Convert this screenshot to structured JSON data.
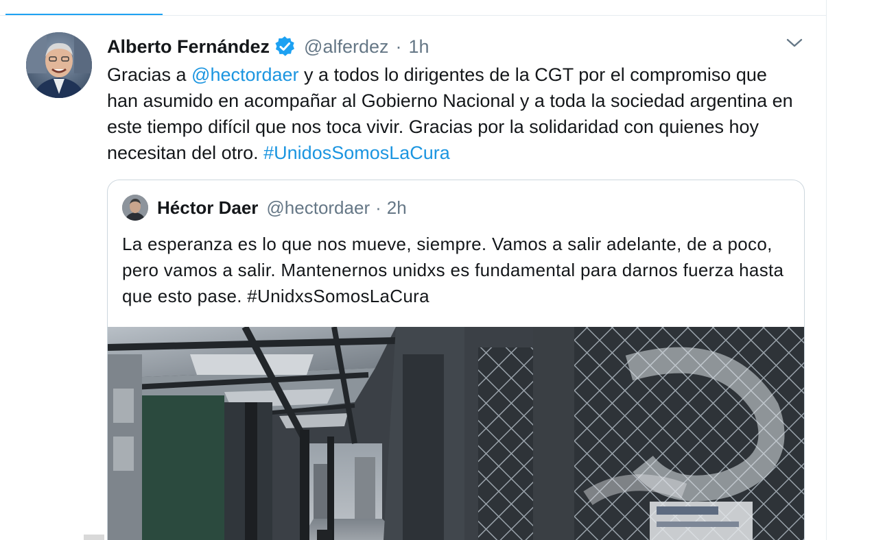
{
  "tweet": {
    "author_name": "Alberto Fernández",
    "author_handle": "@alferdez",
    "separator": "·",
    "time": "1h",
    "text_before": "Gracias a ",
    "mention": "@hectordaer",
    "text_after": " y a todos lo dirigentes de la CGT por el compromiso que han asumido en acompañar al Gobierno Nacional y a toda la sociedad argentina en este tiempo difícil que nos toca vivir. Gracias por la solidaridad con quienes hoy necesitan del otro. ",
    "hashtag": "#UnidosSomosLaCura",
    "icons": {
      "verified": "verified-badge-icon",
      "menu": "chevron-down-icon"
    },
    "accent_color": "#1da1f2",
    "link_color": "#1b95e0"
  },
  "quoted_tweet": {
    "author_name": "Héctor Daer",
    "author_handle": "@hectordaer",
    "separator": "·",
    "time": "2h",
    "text": "La esperanza es lo que nos mueve, siempre. Vamos a salir adelante, de a poco, pero vamos a salir. Mantenernos unidxs  es fundamental para darnos fuerza hasta que esto pase. #UnidxsSomosLaCura",
    "media": {
      "kind": "photo",
      "description_icon": "street-photo"
    }
  }
}
